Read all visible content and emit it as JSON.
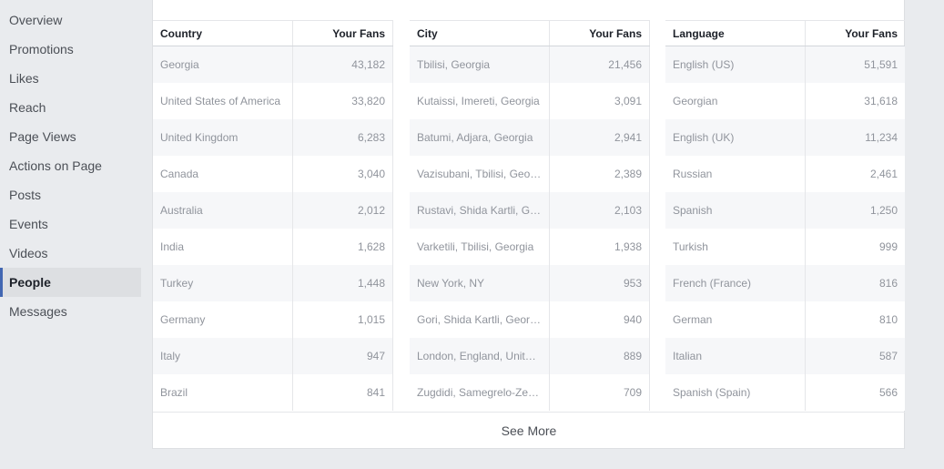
{
  "sidebar": {
    "items": [
      {
        "label": "Overview"
      },
      {
        "label": "Promotions"
      },
      {
        "label": "Likes"
      },
      {
        "label": "Reach"
      },
      {
        "label": "Page Views"
      },
      {
        "label": "Actions on Page"
      },
      {
        "label": "Posts"
      },
      {
        "label": "Events"
      },
      {
        "label": "Videos"
      },
      {
        "label": "People"
      },
      {
        "label": "Messages"
      }
    ],
    "active": "People"
  },
  "tables": [
    {
      "headers": [
        "Country",
        "Your Fans"
      ],
      "rows": [
        [
          "Georgia",
          "43,182"
        ],
        [
          "United States of America",
          "33,820"
        ],
        [
          "United Kingdom",
          "6,283"
        ],
        [
          "Canada",
          "3,040"
        ],
        [
          "Australia",
          "2,012"
        ],
        [
          "India",
          "1,628"
        ],
        [
          "Turkey",
          "1,448"
        ],
        [
          "Germany",
          "1,015"
        ],
        [
          "Italy",
          "947"
        ],
        [
          "Brazil",
          "841"
        ]
      ]
    },
    {
      "headers": [
        "City",
        "Your Fans"
      ],
      "rows": [
        [
          "Tbilisi, Georgia",
          "21,456"
        ],
        [
          "Kutaissi, Imereti, Georgia",
          "3,091"
        ],
        [
          "Batumi, Adjara, Georgia",
          "2,941"
        ],
        [
          "Vazisubani, Tbilisi, Geo…",
          "2,389"
        ],
        [
          "Rustavi, Shida Kartli, G…",
          "2,103"
        ],
        [
          "Varketili, Tbilisi, Georgia",
          "1,938"
        ],
        [
          "New York, NY",
          "953"
        ],
        [
          "Gori, Shida Kartli, Geor…",
          "940"
        ],
        [
          "London, England, Unit…",
          "889"
        ],
        [
          "Zugdidi, Samegrelo-Ze…",
          "709"
        ]
      ]
    },
    {
      "headers": [
        "Language",
        "Your Fans"
      ],
      "rows": [
        [
          "English (US)",
          "51,591"
        ],
        [
          "Georgian",
          "31,618"
        ],
        [
          "English (UK)",
          "11,234"
        ],
        [
          "Russian",
          "2,461"
        ],
        [
          "Spanish",
          "1,250"
        ],
        [
          "Turkish",
          "999"
        ],
        [
          "French (France)",
          "816"
        ],
        [
          "German",
          "810"
        ],
        [
          "Italian",
          "587"
        ],
        [
          "Spanish (Spain)",
          "566"
        ]
      ]
    }
  ],
  "see_more_label": "See More"
}
